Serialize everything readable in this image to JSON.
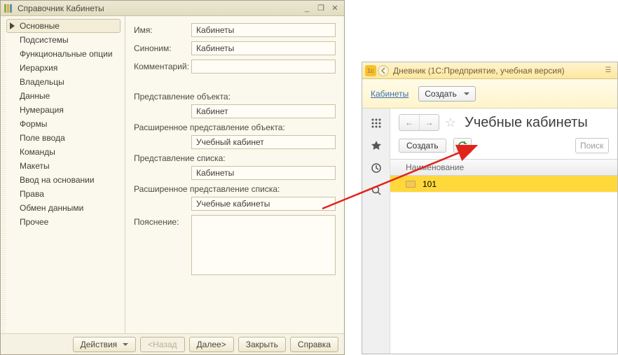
{
  "designer": {
    "title": "Справочник Кабинеты",
    "sidebar": {
      "items": [
        {
          "label": "Основные",
          "active": true
        },
        {
          "label": "Подсистемы"
        },
        {
          "label": "Функциональные опции"
        },
        {
          "label": "Иерархия"
        },
        {
          "label": "Владельцы"
        },
        {
          "label": "Данные"
        },
        {
          "label": "Нумерация"
        },
        {
          "label": "Формы"
        },
        {
          "label": "Поле ввода"
        },
        {
          "label": "Команды"
        },
        {
          "label": "Макеты"
        },
        {
          "label": "Ввод на основании"
        },
        {
          "label": "Права"
        },
        {
          "label": "Обмен данными"
        },
        {
          "label": "Прочее"
        }
      ]
    },
    "fields": {
      "name_label": "Имя:",
      "name_value": "Кабинеты",
      "synonym_label": "Синоним:",
      "synonym_value": "Кабинеты",
      "comment_label": "Комментарий:",
      "comment_value": "",
      "obj_repr_label": "Представление объекта:",
      "obj_repr_value": "Кабинет",
      "ext_obj_repr_label": "Расширенное представление объекта:",
      "ext_obj_repr_value": "Учебный кабинет",
      "list_repr_label": "Представление списка:",
      "list_repr_value": "Кабинеты",
      "ext_list_repr_label": "Расширенное представление списка:",
      "ext_list_repr_value": "Учебные кабинеты",
      "explanation_label": "Пояснение:",
      "explanation_value": ""
    },
    "footer": {
      "actions": "Действия",
      "back": "<Назад",
      "next": "Далее>",
      "close": "Закрыть",
      "help": "Справка"
    }
  },
  "runtime": {
    "title": "Дневник  (1C:Предприятие, учебная версия)",
    "toolbar": {
      "link": "Кабинеты",
      "create": "Создать"
    },
    "heading": "Учебные кабинеты",
    "actions": {
      "create": "Создать",
      "search_placeholder": "Поиск"
    },
    "grid": {
      "header": "Наименование",
      "rows": [
        {
          "name": "101"
        }
      ]
    }
  }
}
